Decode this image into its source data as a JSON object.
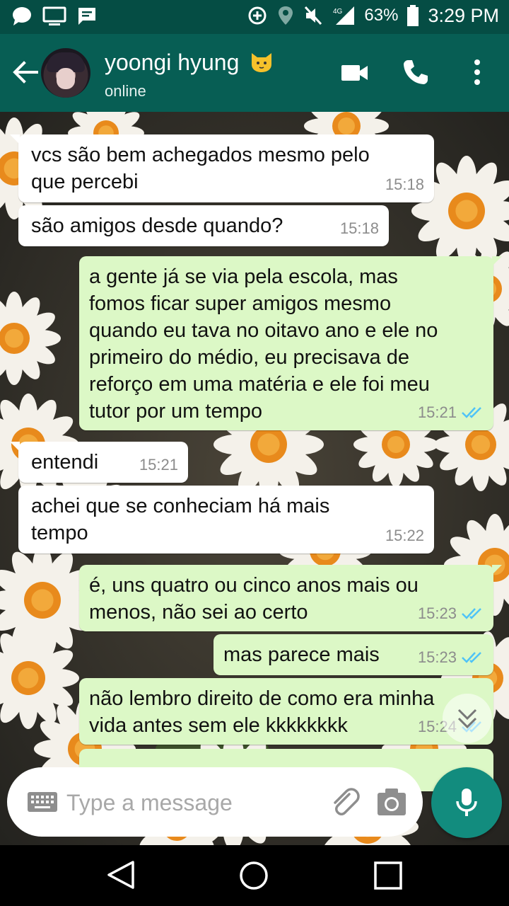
{
  "status_bar": {
    "battery": "63%",
    "network": "4G",
    "time": "3:29 PM"
  },
  "header": {
    "contact_name": "yoongi hyung",
    "contact_status": "online"
  },
  "messages": [
    {
      "direction": "in",
      "text_lines": [
        "vcs são bem achegados mesmo pelo",
        "que percebi"
      ],
      "time": "15:18"
    },
    {
      "direction": "in",
      "text_lines": [
        "são amigos desde quando?"
      ],
      "time": "15:18"
    },
    {
      "direction": "out",
      "text_lines": [
        "a gente já se via pela escola, mas",
        "fomos ficar super amigos mesmo",
        "quando eu tava no oitavo ano e ele no",
        "primeiro do médio, eu precisava de",
        "reforço em uma matéria e ele foi meu",
        "tutor por um tempo"
      ],
      "time": "15:21",
      "read": true
    },
    {
      "direction": "in",
      "text_lines": [
        "entendi"
      ],
      "time": "15:21"
    },
    {
      "direction": "in",
      "text_lines": [
        "achei que se conheciam há mais",
        "tempo"
      ],
      "time": "15:22"
    },
    {
      "direction": "out",
      "text_lines": [
        "é, uns quatro ou cinco anos mais ou",
        "menos, não sei ao certo"
      ],
      "time": "15:23",
      "read": true
    },
    {
      "direction": "out",
      "text_lines": [
        "mas parece mais"
      ],
      "time": "15:23",
      "read": true
    },
    {
      "direction": "out",
      "text_lines": [
        "não lembro direito de como era minha",
        "vida antes sem ele kkkkkkkk"
      ],
      "time": "15:24",
      "read": true
    }
  ],
  "composer": {
    "placeholder": "Type a message"
  },
  "colors": {
    "status_bar": "#054d44",
    "app_bar": "#075e54",
    "outgoing_bubble": "#dcf8c6",
    "incoming_bubble": "#ffffff",
    "mic_button": "#128c7e",
    "read_ticks": "#4fc3f7"
  },
  "icons": {
    "status_left": [
      "chat-bubble-icon",
      "monitor-icon",
      "message-icon"
    ],
    "status_right": [
      "data-saver-icon",
      "location-icon",
      "mute-icon",
      "signal-icon",
      "battery-icon"
    ],
    "header": [
      "back-arrow-icon",
      "cat-emoji-icon",
      "video-call-icon",
      "phone-icon",
      "more-vert-icon"
    ],
    "composer": [
      "keyboard-icon",
      "attach-icon",
      "camera-icon",
      "mic-icon"
    ],
    "nav": [
      "nav-back-icon",
      "nav-home-icon",
      "nav-recents-icon"
    ]
  }
}
